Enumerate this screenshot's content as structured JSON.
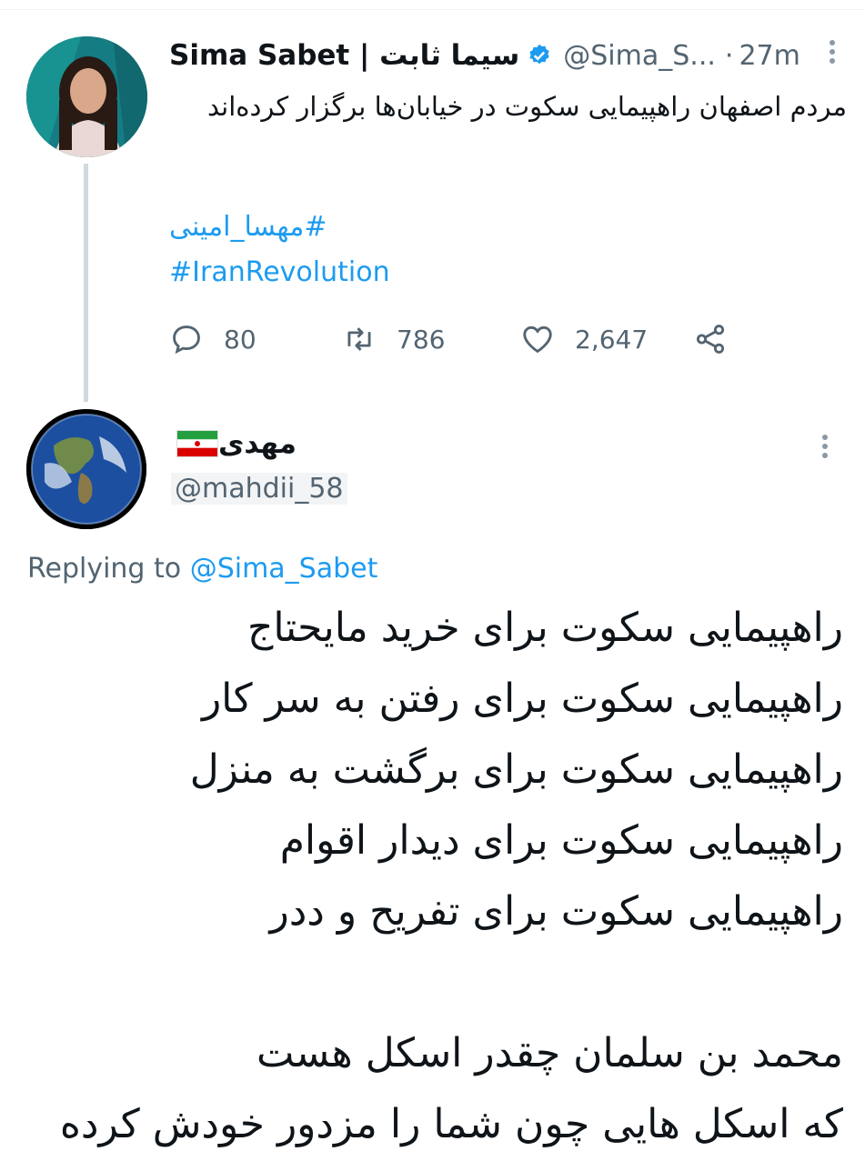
{
  "tweet": {
    "display_name": "Sima Sabet | سیما ثابت",
    "handle": "@Sima_S...",
    "separator": "·",
    "time": "27m",
    "text": "مردم اصفهان راهپیمایی سکوت در خیابان‌ها برگزار کرده‌اند",
    "hashtag_fa": "#مهسا_امینی",
    "hashtag_en": "#IranRevolution",
    "stats": {
      "replies": "80",
      "retweets": "786",
      "likes": "2,647"
    }
  },
  "reply": {
    "display_name": "مهدی",
    "handle": "@mahdii_58",
    "replying_prefix": "Replying to",
    "replying_to": "@Sima_Sabet",
    "lines": [
      "راهپیمایی سکوت برای خرید مایحتاج",
      "راهپیمایی سکوت برای رفتن به سر کار",
      "راهپیمایی سکوت برای برگشت به منزل",
      "راهپیمایی سکوت برای دیدار اقوام",
      "راهپیمایی سکوت برای تفریح و ددر",
      "",
      "محمد بن سلمان چقدر اسکل هست",
      "که اسکل هایی چون شما را مزدور خودش کرده"
    ]
  },
  "colors": {
    "link": "#1d9bf0",
    "muted": "#536471",
    "text": "#0f1419"
  },
  "icons": [
    "reply-icon",
    "retweet-icon",
    "like-icon",
    "share-icon",
    "verified-icon",
    "more-icon",
    "iran-flag-icon"
  ]
}
